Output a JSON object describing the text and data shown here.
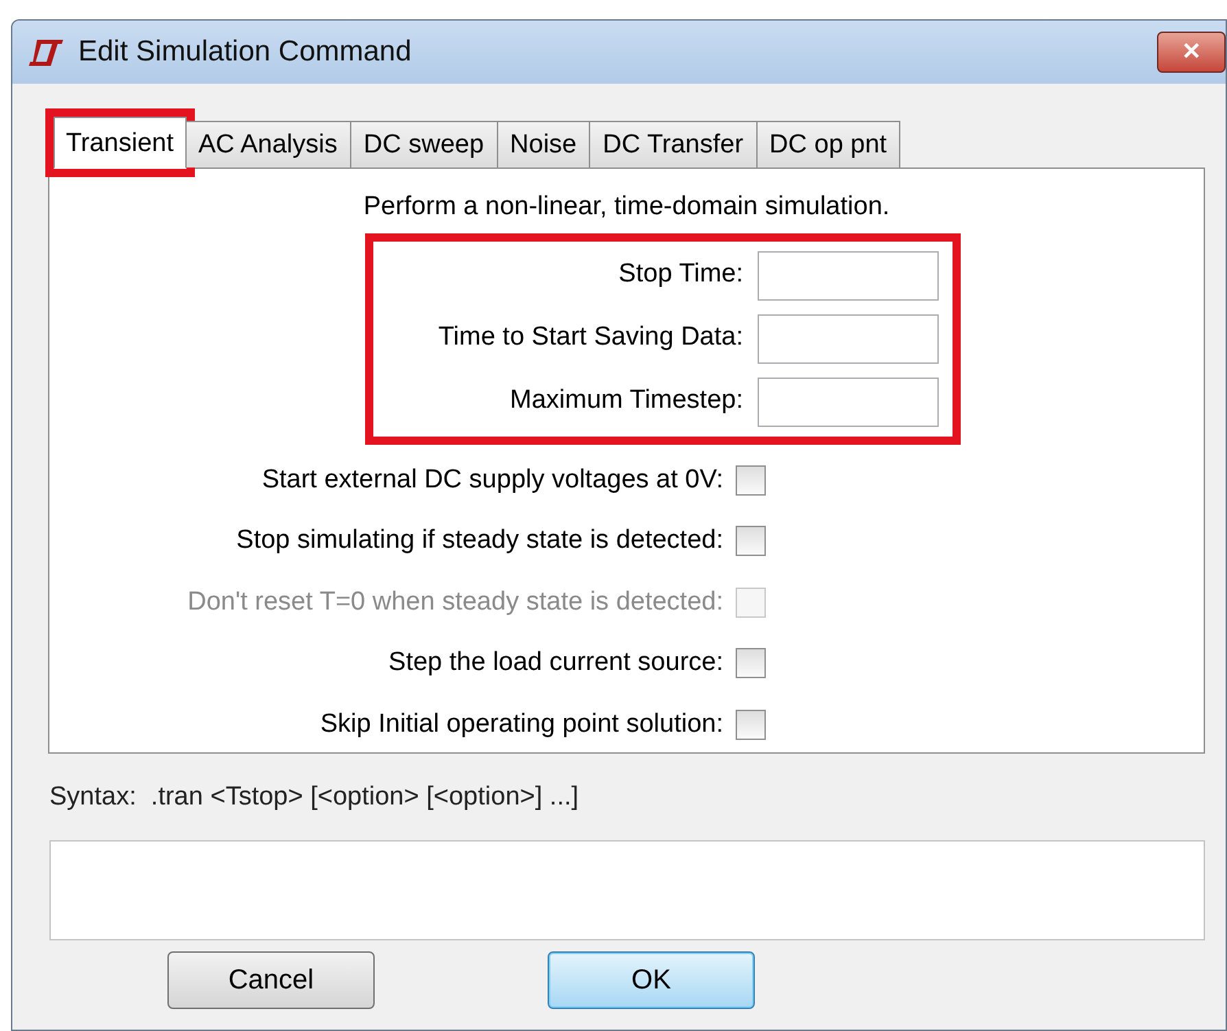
{
  "window": {
    "title": "Edit Simulation Command",
    "close": "✕"
  },
  "tabs": [
    {
      "label": "Transient",
      "selected": true,
      "highlighted": true
    },
    {
      "label": "AC Analysis",
      "selected": false,
      "highlighted": false
    },
    {
      "label": "DC sweep",
      "selected": false,
      "highlighted": false
    },
    {
      "label": "Noise",
      "selected": false,
      "highlighted": false
    },
    {
      "label": "DC Transfer",
      "selected": false,
      "highlighted": false
    },
    {
      "label": "DC op pnt",
      "selected": false,
      "highlighted": false
    }
  ],
  "description": "Perform a non-linear, time-domain simulation.",
  "fields_highlighted": true,
  "fields": [
    {
      "label": "Stop Time:"
    },
    {
      "label": "Time to Start Saving Data:"
    },
    {
      "label": "Maximum Timestep:"
    }
  ],
  "options": [
    {
      "label": "Start external DC supply voltages at 0V:",
      "checked": false,
      "disabled": false
    },
    {
      "label": "Stop simulating if steady state is detected:",
      "checked": false,
      "disabled": false
    },
    {
      "label": "Don't reset T=0 when steady state is detected:",
      "checked": false,
      "disabled": true
    },
    {
      "label": "Step the load current source:",
      "checked": false,
      "disabled": false
    },
    {
      "label": "Skip Initial operating point solution:",
      "checked": false,
      "disabled": false
    }
  ],
  "syntax": "Syntax:  .tran <Tstop> [<option> [<option>] ...]",
  "buttons": [
    {
      "label": "Cancel",
      "default": false
    },
    {
      "label": "OK",
      "default": true
    }
  ]
}
